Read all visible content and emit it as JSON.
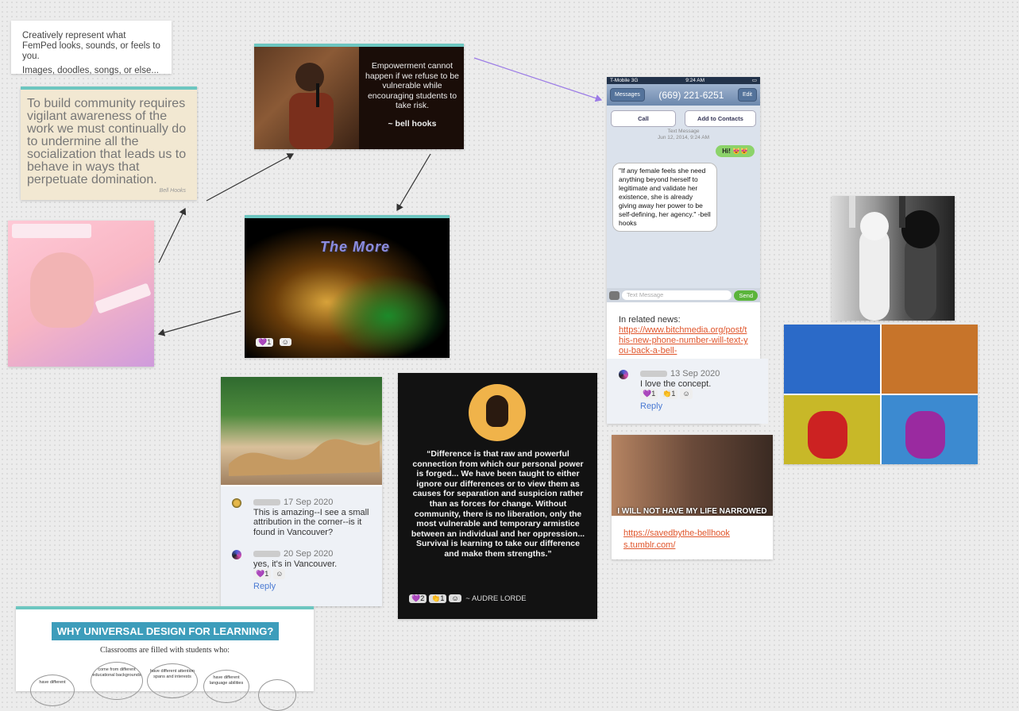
{
  "prompt": {
    "line1": "Creatively represent what FemPed looks, sounds, or feels to you.",
    "line2": "Images, doodles, songs, or else..."
  },
  "quote_card": {
    "text": "To build community requires vigilant awareness of the work we must continually do to undermine all the socialization that leads us to behave in ways that perpetuate domination.",
    "signature": "Bell Hooks"
  },
  "bell_card": {
    "quote": "Empowerment cannot happen if we refuse to be vulnerable while encouraging students to take risk.",
    "source": "~ bell hooks"
  },
  "phone": {
    "status_left": "T-Mobile  3G",
    "status_time": "9:24 AM",
    "messages_btn": "Messages",
    "number": "(669) 221-6251",
    "edit_btn": "Edit",
    "call_btn": "Call",
    "add_btn": "Add to Contacts",
    "meta1": "Text Message",
    "meta2": "Jun 12, 2014, 9:24 AM",
    "sent": "Hi! 😻😻",
    "received": "\"If any female feels she need anything beyond herself to legitimate and validate her existence, she is already giving away her power to be self-defining, her agency.\" -bell hooks",
    "placeholder": "Text Message",
    "send": "Send"
  },
  "news": {
    "label": "In related news:",
    "link": "https://www.bitchmedia.org/post/this-new-phone-number-will-text-you-back-a-bell-"
  },
  "phone_comment": {
    "date": "13 Sep 2020",
    "text": "I love the concept.",
    "reactions": [
      "💜1",
      "👏1"
    ],
    "reply": "Reply"
  },
  "one_card": {
    "title": "The More",
    "reactions": [
      "💜1"
    ]
  },
  "street_comments": [
    {
      "date": "17 Sep 2020",
      "text": "This is amazing--I see a small attribution in the corner--is it found in Vancouver?"
    },
    {
      "date": "20 Sep 2020",
      "text": "yes, it's in Vancouver.",
      "reactions": [
        "💜1"
      ]
    }
  ],
  "street_reply": "Reply",
  "lorde": {
    "quote": "“Difference is that raw and powerful connection from which our personal power is forged... We have been taught to either ignore our differences or to view them as causes for separation and suspicion rather than as forces for change. Without community, there is no liberation, only the most vulnerable and temporary armistice between an individual and her oppression... Survival is learning to take our difference and make them strengths.”",
    "author": "~ AUDRE LORDE",
    "reactions": [
      "💜2",
      "👏1"
    ]
  },
  "saved": {
    "caption": "I WILL NOT HAVE MY LIFE NARROWED",
    "link": "https://savedbythe-bellhooks.tumblr.com/"
  },
  "udl": {
    "title": "WHY UNIVERSAL DESIGN FOR LEARNING?",
    "subtitle": "Classrooms are filled with students who:",
    "bubbles": [
      "have different",
      "come from different educational backgrounds",
      "have different attention spans and interests",
      "have different language abilities",
      ""
    ]
  },
  "colors": {
    "accent_teal": "#6cc6c0",
    "link_orange": "#e0552b",
    "reply_blue": "#4a7ad3",
    "connector_purple": "#9b7be6"
  }
}
